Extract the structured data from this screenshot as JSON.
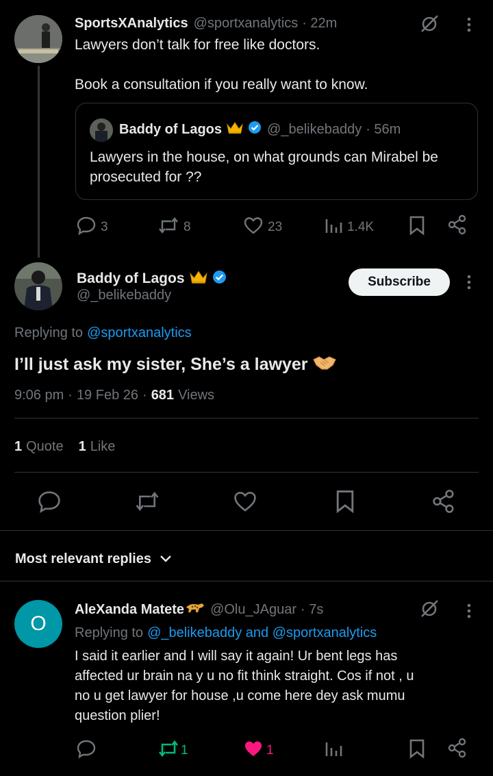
{
  "post1": {
    "name": "SportsXAnalytics",
    "handle": "@sportxanalytics",
    "time": "· 22m",
    "line1": "Lawyers don’t talk for free like doctors.",
    "line2": "Book a consultation if you really want to know.",
    "quoted": {
      "name": "Baddy of Lagos",
      "handle": "@_belikebaddy",
      "time": "· 56m",
      "text": "Lawyers in the house, on what grounds can Mirabel be prosecuted for  ??"
    },
    "replies": "3",
    "reposts": "8",
    "likes": "23",
    "views": "1.4K"
  },
  "main": {
    "name": "Baddy of Lagos",
    "handle": "@_belikebaddy",
    "subscribe_label": "Subscribe",
    "replying_prefix": "Replying to",
    "replying_to": "@sportxanalytics",
    "text": "I’ll just ask my sister, She’s a lawyer",
    "time": "9:06 pm",
    "date": "19 Feb 26",
    "views_count": "681",
    "views_label": "Views",
    "quotes_count": "1",
    "quotes_label": "Quote",
    "likes_count": "1",
    "likes_label": "Like"
  },
  "sort": {
    "label": "Most relevant replies"
  },
  "reply1": {
    "avatar_letter": "O",
    "name": "AleXanda Matete",
    "handle": "@Olu_JAguar",
    "time": "· 7s",
    "replying_prefix": "Replying to",
    "replying_to": "@_belikebaddy and @sportxanalytics",
    "text_lines": [
      "I said it earlier and I will say it again! Ur bent legs has",
      "affected ur brain na y u no fit think straight. Cos if not , u",
      "no u get lawyer for house ,u come here dey ask mumu",
      "question plier!"
    ],
    "reposts": "1",
    "likes": "1"
  },
  "colors": {
    "accent": "#1d9bf0",
    "repost_active": "#00ba7c",
    "like_active": "#f91880",
    "muted": "#71767b",
    "crown": "#f4b400"
  }
}
